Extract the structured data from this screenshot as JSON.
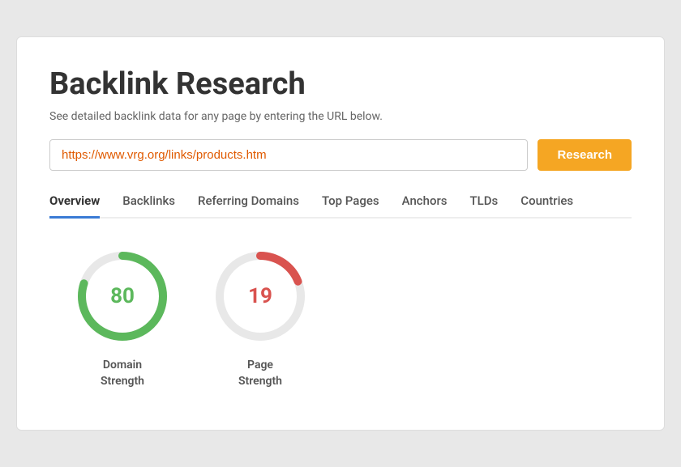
{
  "page": {
    "title": "Backlink Research",
    "subtitle": "See detailed backlink data for any page by entering the URL below.",
    "url_value": "https://www.vrg.org/links/products.htm",
    "research_button": "Research"
  },
  "tabs": [
    {
      "id": "overview",
      "label": "Overview",
      "active": true
    },
    {
      "id": "backlinks",
      "label": "Backlinks",
      "active": false
    },
    {
      "id": "referring-domains",
      "label": "Referring Domains",
      "active": false
    },
    {
      "id": "top-pages",
      "label": "Top Pages",
      "active": false
    },
    {
      "id": "anchors",
      "label": "Anchors",
      "active": false
    },
    {
      "id": "tlds",
      "label": "TLDs",
      "active": false
    },
    {
      "id": "countries",
      "label": "Countries",
      "active": false
    }
  ],
  "metrics": [
    {
      "id": "domain-strength",
      "value": "80",
      "label": "Domain\nStrength",
      "color": "green",
      "stroke_color": "#5cb85c",
      "track_color": "#e8e8e8",
      "percent": 80
    },
    {
      "id": "page-strength",
      "value": "19",
      "label": "Page\nStrength",
      "color": "red",
      "stroke_color": "#d9534f",
      "track_color": "#e8e8e8",
      "percent": 19
    }
  ]
}
